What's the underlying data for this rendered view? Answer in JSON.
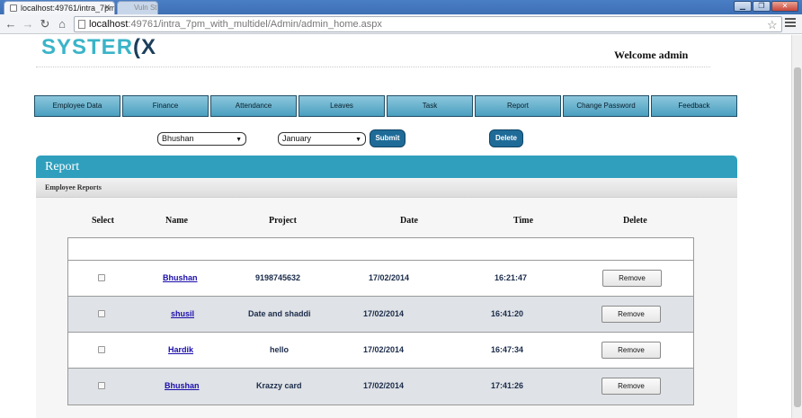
{
  "browser": {
    "active_tab_title": "localhost:49761/intra_7pm",
    "inactive_tab_title": "Vuln Study",
    "url_host": "localhost",
    "url_path": ":49761/intra_7pm_with_multidel/Admin/admin_home.aspx"
  },
  "header": {
    "logo_part1": "SYSTER",
    "logo_part2": "(X",
    "welcome": "Welcome admin"
  },
  "nav": {
    "items": [
      {
        "label": "Employee  Data"
      },
      {
        "label": "Finance"
      },
      {
        "label": "Attendance"
      },
      {
        "label": "Leaves"
      },
      {
        "label": "Task"
      },
      {
        "label": "Report"
      },
      {
        "label": "Change Password"
      },
      {
        "label": "Feedback"
      }
    ]
  },
  "filters": {
    "employee_selected": "Bhushan",
    "month_selected": "January",
    "submit_label": "Submit",
    "delete_label": "Delete"
  },
  "panel": {
    "title": "Report",
    "subtitle": "Employee Reports"
  },
  "table": {
    "columns": [
      "Select",
      "Name",
      "Project",
      "Date",
      "Time",
      "Delete"
    ],
    "remove_label": "Remove",
    "rows": [
      {
        "name": "Bhushan",
        "project": "9198745632",
        "date": "17/02/2014",
        "time": "16:21:47"
      },
      {
        "name": "shusil",
        "project": "Date and shaddi",
        "date": "17/02/2014",
        "time": "16:41:20"
      },
      {
        "name": "Hardik",
        "project": "hello",
        "date": "17/02/2014",
        "time": "16:47:34"
      },
      {
        "name": "Bhushan",
        "project": "Krazzy card",
        "date": "17/02/2014",
        "time": "17:41:26"
      }
    ]
  }
}
